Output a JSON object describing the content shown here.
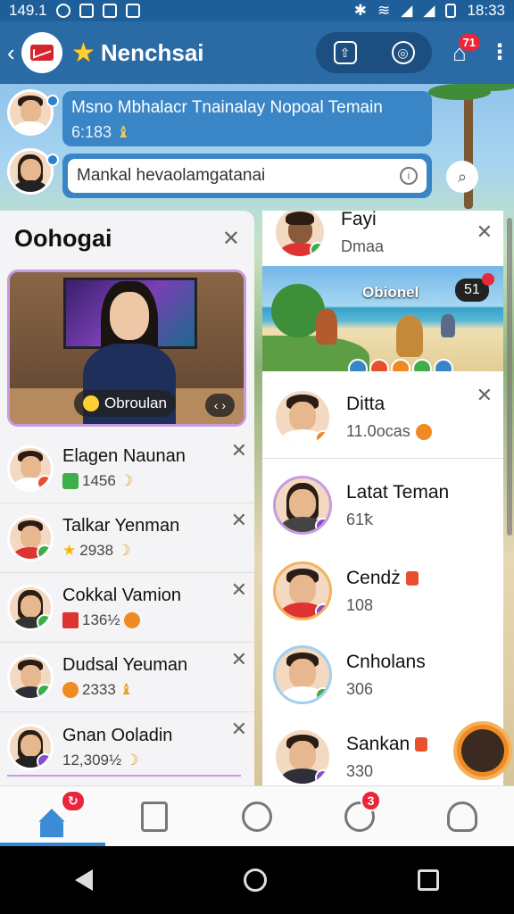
{
  "status_bar": {
    "time_left": "149.1",
    "time_right": "18:33"
  },
  "app_bar": {
    "title": "Nenchsai",
    "notification_count": "71"
  },
  "chat": {
    "message_title": "Msno Mbhalacr Tnainalay Nopoal Temain",
    "message_time": "6:183",
    "input_placeholder": "Mankal hevaolamgatanai"
  },
  "left_panel": {
    "title": "Oohogai",
    "video_chip": "Obroulan",
    "video_ctrl": "‹ ›",
    "items": [
      {
        "name": "Elagen Naunan",
        "value": "1456"
      },
      {
        "name": "Talkar Yenman",
        "value": "2938"
      },
      {
        "name": "Cokkal Vamion",
        "value": "136½"
      },
      {
        "name": "Dudsal Yeuman",
        "value": "2333"
      },
      {
        "name": "Gnan Ooladin",
        "value": "12,309½"
      }
    ]
  },
  "right_panel": {
    "top_item": {
      "name": "Fayi",
      "sub": "Dmaa"
    },
    "game": {
      "label": "Obionel",
      "score": "51"
    },
    "items": [
      {
        "name": "Ditta",
        "sub": "11.0ocas"
      },
      {
        "name": "Latat Teman",
        "sub": "61ꝁ"
      },
      {
        "name": "Cendż",
        "sub": "108"
      },
      {
        "name": "Cnholans",
        "sub": "306"
      },
      {
        "name": "Sankan",
        "sub": "330"
      }
    ]
  },
  "bottom_nav": {
    "home_badge": "↻",
    "games_badge": "3"
  },
  "colors": {
    "accent": "#2a6aa5",
    "badge": "#e8273b",
    "purple": "#c79be0"
  }
}
